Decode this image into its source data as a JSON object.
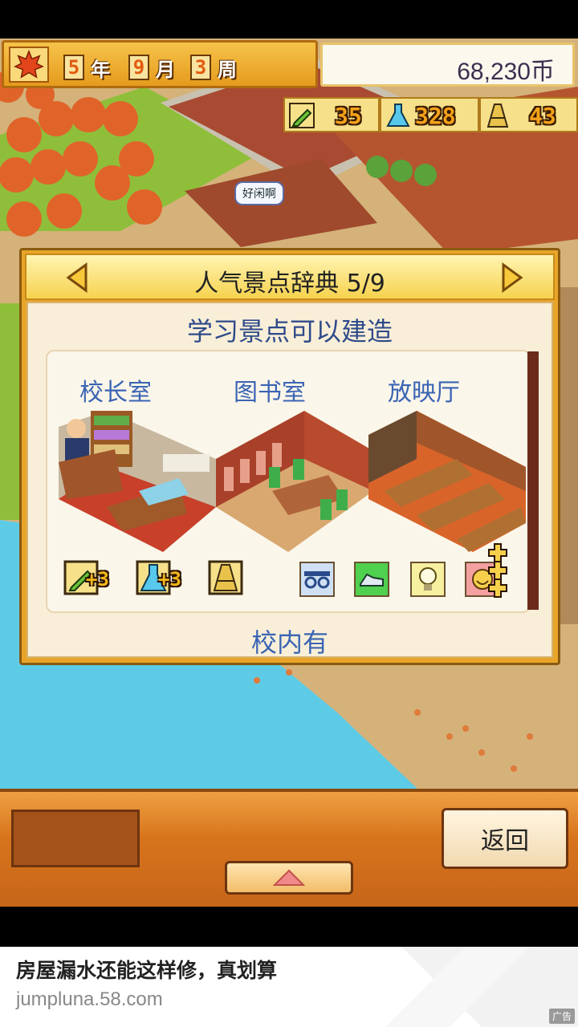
{
  "hud": {
    "year": "5",
    "year_unit": "年",
    "month": "9",
    "month_unit": "月",
    "week": "3",
    "week_unit": "周",
    "money": "68,230币",
    "stats": [
      {
        "icon": "pencil-icon",
        "value": "35"
      },
      {
        "icon": "flask-icon",
        "value": "328"
      },
      {
        "icon": "rank-cone-icon",
        "value": "43"
      }
    ]
  },
  "speech_bubble": "好闲啊",
  "dialog": {
    "title": "人气景点辞典 5/9",
    "subtitle": "学习景点可以建造",
    "rooms": [
      {
        "name": "校长室"
      },
      {
        "name": "图书室"
      },
      {
        "name": "放映厅"
      }
    ],
    "badges": [
      {
        "icon": "pencil-icon",
        "text": "+3"
      },
      {
        "icon": "flask-icon",
        "text": "+3"
      },
      {
        "icon": "rank-cone-icon"
      }
    ],
    "trait_icons": [
      "glasses-icon",
      "shoe-icon",
      "lightbulb-icon",
      "smile-face-icon"
    ],
    "footer": "校内有"
  },
  "toolbar": {
    "back_label": "返回"
  },
  "ad": {
    "title": "房屋漏水还能这样修，真划算",
    "url": "jumpluna.58.com",
    "tag": "广告"
  },
  "colors": {
    "accent_orange": "#e8a52a",
    "title_blue": "#2e4a8a",
    "room_blue": "#3a64b4",
    "water": "#5ecbe6"
  }
}
